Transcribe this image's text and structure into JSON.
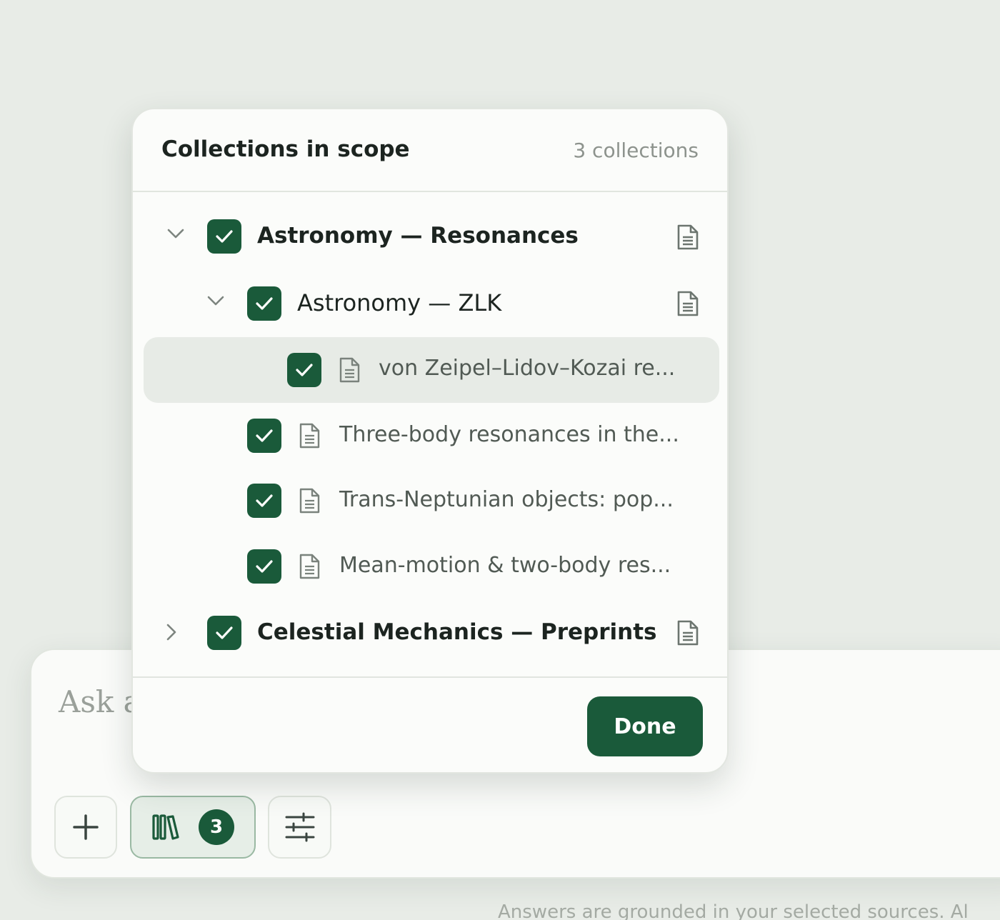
{
  "composer": {
    "placeholder": "Ask a",
    "footer_note": "Answers are grounded in your selected sources. Al"
  },
  "toolbar": {
    "add_icon": "plus-icon",
    "scope_icon": "library-books-icon",
    "scope_count": "3",
    "settings_icon": "sliders-icon"
  },
  "popover": {
    "title": "Collections in scope",
    "count_label": "3 collections",
    "items": [
      {
        "label": "Astronomy — Resonances",
        "checked": true,
        "expanded": true,
        "type": "collection"
      },
      {
        "label": "Astronomy — ZLK",
        "checked": true,
        "expanded": true,
        "type": "collection"
      },
      {
        "label": "von Zeipel–Lidov–Kozai re...",
        "checked": true,
        "type": "document",
        "highlighted": true
      },
      {
        "label": "Three-body resonances in the...",
        "checked": true,
        "type": "document"
      },
      {
        "label": "Trans-Neptunian objects: pop...",
        "checked": true,
        "type": "document"
      },
      {
        "label": "Mean-motion & two-body res...",
        "checked": true,
        "type": "document"
      },
      {
        "label": "Celestial Mechanics — Preprints",
        "checked": true,
        "expanded": false,
        "type": "collection"
      }
    ],
    "done_label": "Done"
  },
  "colors": {
    "accent": "#1a5a3a",
    "background": "#e8ece7",
    "panel": "#fbfcfa",
    "highlight_row": "#e7ebe6"
  }
}
